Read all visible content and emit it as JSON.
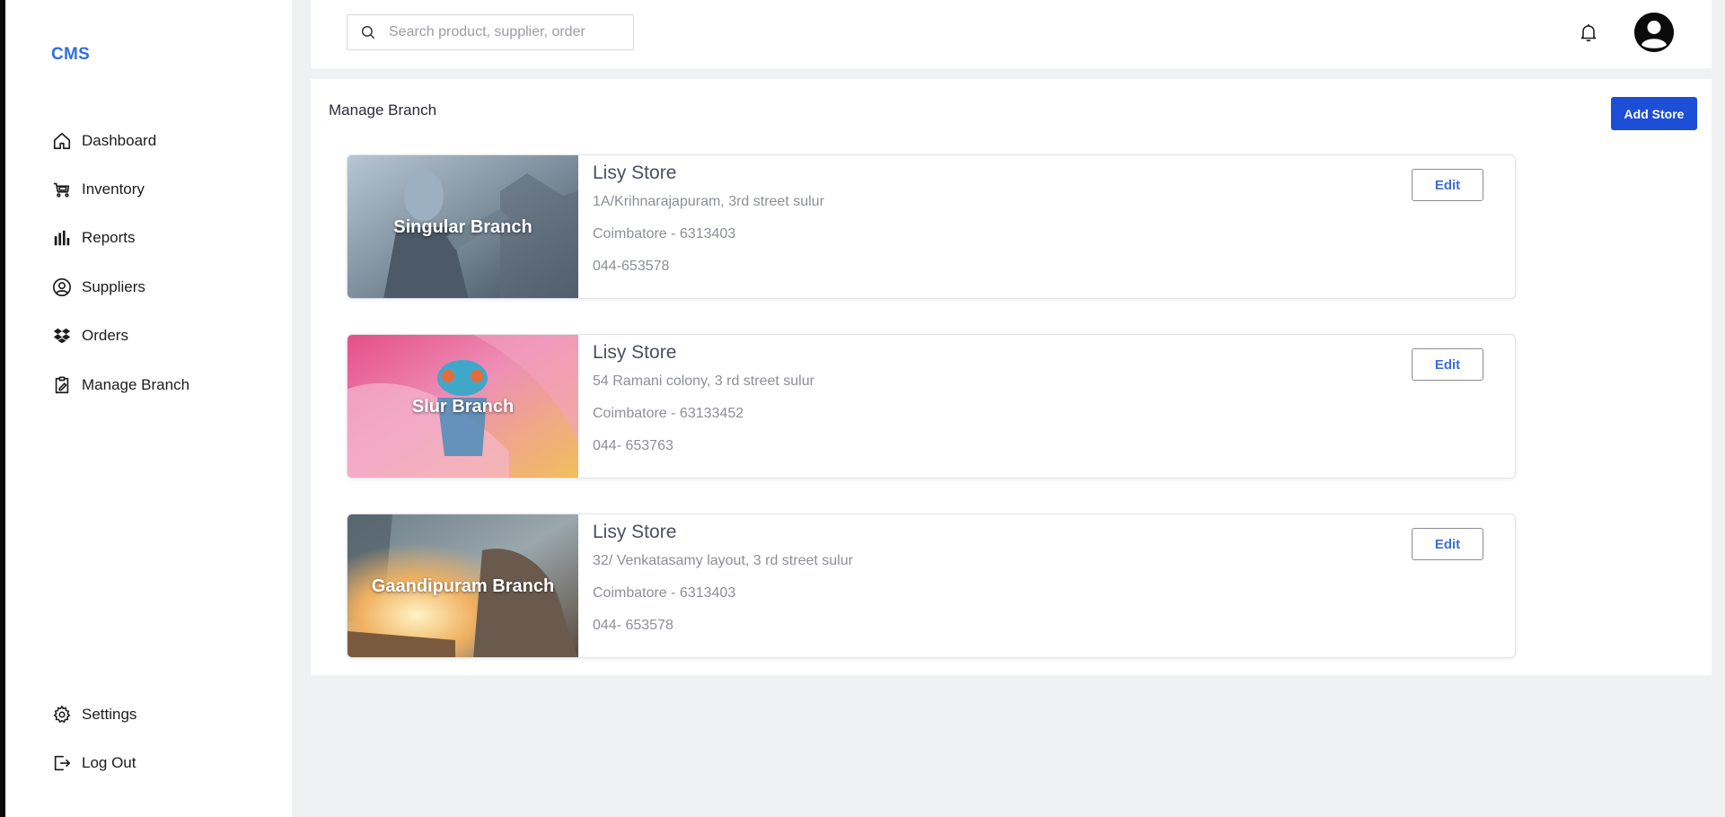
{
  "brand": "CMS",
  "sidebar": {
    "items": [
      {
        "label": "Dashboard",
        "icon": "home-icon"
      },
      {
        "label": "Inventory",
        "icon": "cart-icon"
      },
      {
        "label": "Reports",
        "icon": "bar-chart-icon"
      },
      {
        "label": "Suppliers",
        "icon": "user-circle-icon"
      },
      {
        "label": "Orders",
        "icon": "dropbox-icon"
      },
      {
        "label": "Manage Branch",
        "icon": "clipboard-edit-icon"
      }
    ],
    "bottom_items": [
      {
        "label": "Settings",
        "icon": "gear-icon"
      },
      {
        "label": "Log Out",
        "icon": "logout-icon"
      }
    ]
  },
  "search": {
    "placeholder": "Search product, supplier, order",
    "value": ""
  },
  "header_icons": {
    "notifications": "bell-icon",
    "profile": "avatar-icon"
  },
  "page": {
    "title": "Manage Branch",
    "add_label": "Add Store"
  },
  "stores": [
    {
      "branch": "Singular Branch",
      "name": "Lisy Store",
      "address": "1A/Krihnarajapuram, 3rd street sulur",
      "city": "Coimbatore - 6313403",
      "phone": "044-653578",
      "edit_label": "Edit"
    },
    {
      "branch": "Slur Branch",
      "name": "Lisy Store",
      "address": "54 Ramani colony, 3 rd street sulur",
      "city": "Coimbatore - 63133452",
      "phone": "044- 653763",
      "edit_label": "Edit"
    },
    {
      "branch": "Gaandipuram Branch",
      "name": "Lisy Store",
      "address": "32/ Venkatasamy layout, 3 rd street sulur",
      "city": "Coimbatore - 6313403",
      "phone": "044- 653578",
      "edit_label": "Edit"
    }
  ],
  "colors": {
    "brand": "#2f6fe0",
    "primary_button": "#1d4ed8",
    "edit_text": "#3b6fd8",
    "background": "#f0f1f3"
  }
}
